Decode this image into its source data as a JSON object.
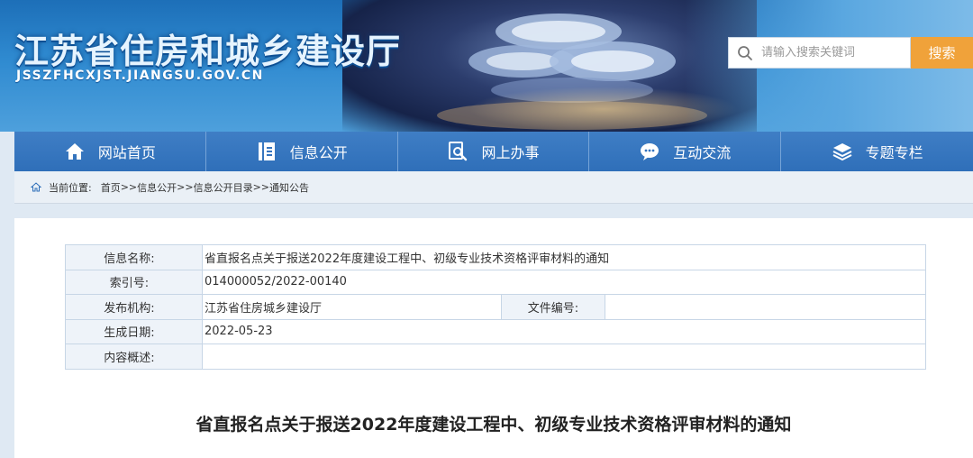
{
  "header": {
    "site_title": "江苏省住房和城乡建设厅",
    "site_url": "JSSZFHCXJST.JIANGSU.GOV.CN",
    "search": {
      "placeholder": "请输入搜索关键词",
      "button_label": "搜索"
    }
  },
  "nav": {
    "items": [
      {
        "label": "网站首页",
        "icon": "home-icon"
      },
      {
        "label": "信息公开",
        "icon": "document-icon"
      },
      {
        "label": "网上办事",
        "icon": "search-document-icon"
      },
      {
        "label": "互动交流",
        "icon": "chat-icon"
      },
      {
        "label": "专题专栏",
        "icon": "layers-icon"
      }
    ]
  },
  "breadcrumb": {
    "prefix": "当前位置:",
    "items": [
      "首页",
      "信息公开",
      "信息公开目录",
      "通知公告"
    ],
    "separator": ">>"
  },
  "meta": {
    "name_label": "信息名称:",
    "name_value": "省直报名点关于报送2022年度建设工程中、初级专业技术资格评审材料的通知",
    "index_label": "索引号:",
    "index_value": "014000052/2022-00140",
    "org_label": "发布机构:",
    "org_value": "江苏省住房城乡建设厅",
    "docno_label": "文件编号:",
    "docno_value": "",
    "date_label": "生成日期:",
    "date_value": "2022-05-23",
    "summary_label": "内容概述:",
    "summary_value": ""
  },
  "document": {
    "title": "省直报名点关于报送2022年度建设工程中、初级专业技术资格评审材料的通知"
  },
  "colors": {
    "nav_bg": "#3574bf",
    "search_button": "#f0a23a",
    "table_border": "#c7d6e6",
    "label_bg": "#eef3f9"
  }
}
